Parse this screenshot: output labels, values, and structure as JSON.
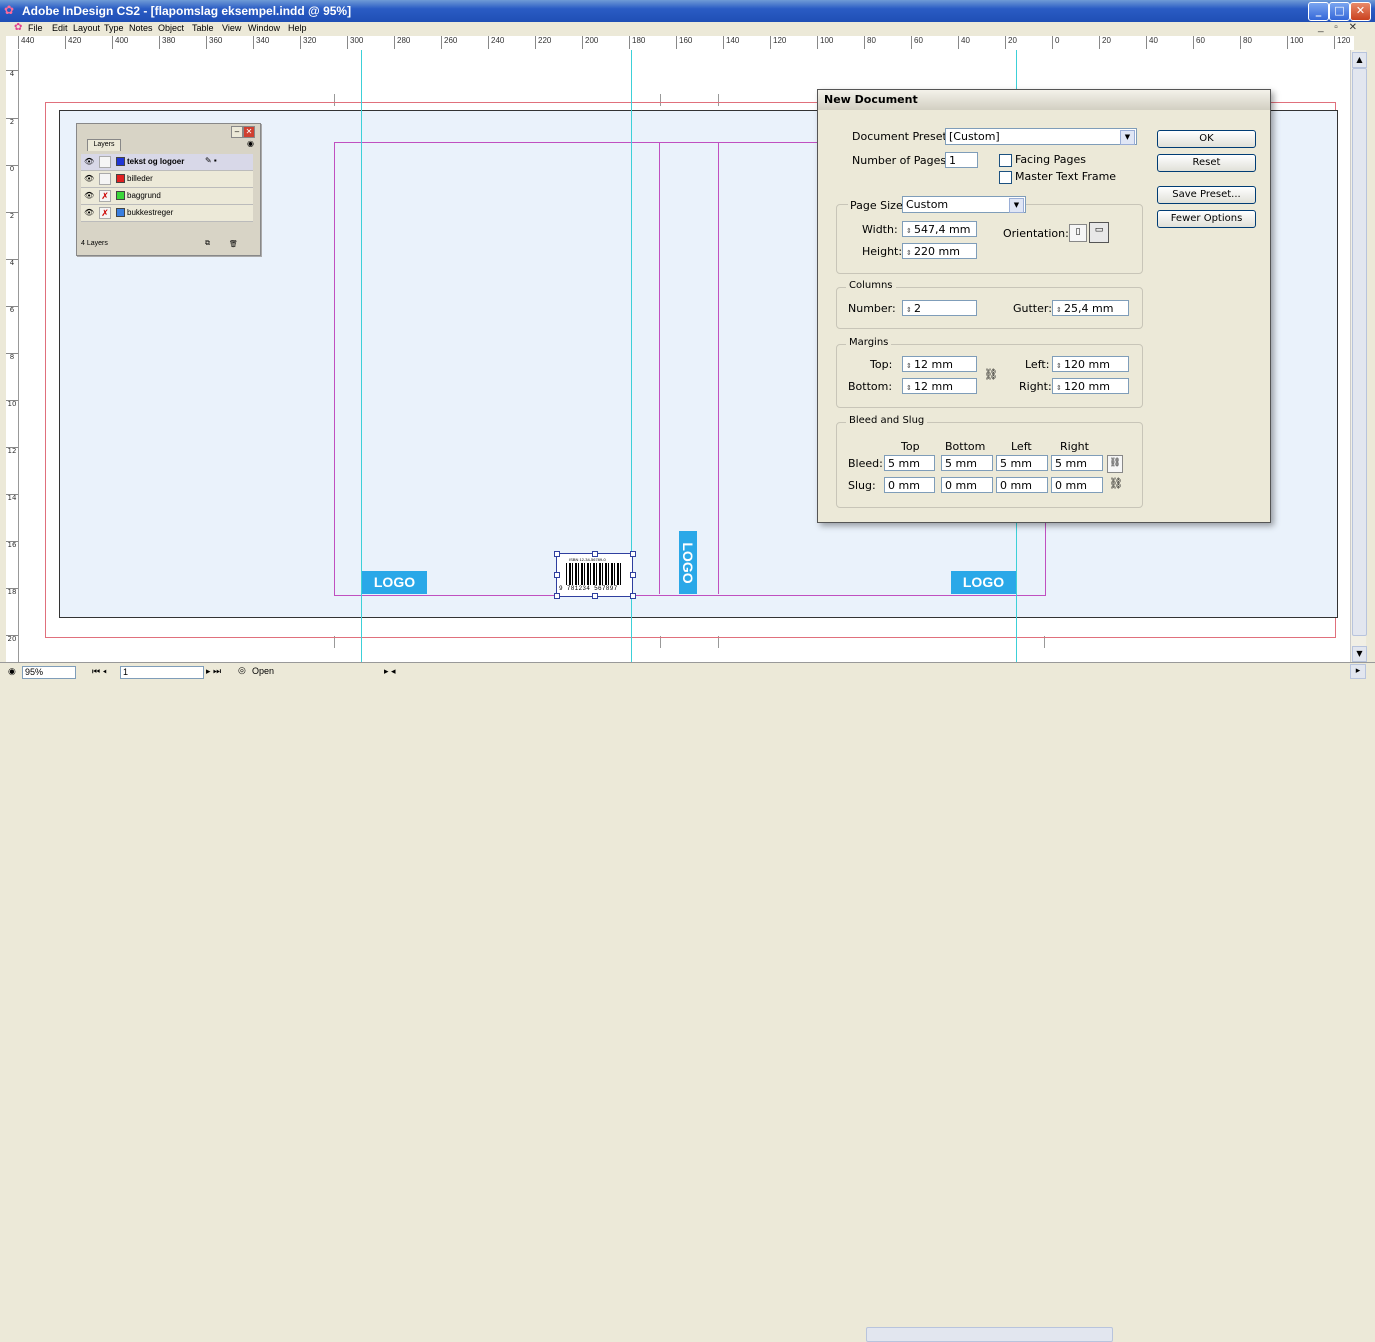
{
  "window": {
    "title": "Adobe InDesign CS2 - [flapomslag eksempel.indd @ 95%]"
  },
  "menu": [
    "File",
    "Edit",
    "Layout",
    "Type",
    "Notes",
    "Object",
    "Table",
    "View",
    "Window",
    "Help"
  ],
  "ruler_top_ticks": [
    "440",
    "420",
    "400",
    "380",
    "360",
    "340",
    "320",
    "300",
    "280",
    "260",
    "240",
    "220",
    "200",
    "180",
    "160",
    "140",
    "120",
    "100",
    "80",
    "60",
    "40",
    "20",
    "0",
    "20",
    "40",
    "60",
    "80",
    "100",
    "120"
  ],
  "ruler_left_ticks": [
    "4",
    "2",
    "0",
    "2",
    "4",
    "6",
    "8",
    "10",
    "12",
    "14",
    "16",
    "18",
    "20"
  ],
  "layers": {
    "tab": "Layers",
    "rows": [
      {
        "name": "tekst og logoer",
        "color": "#1f35d6"
      },
      {
        "name": "billeder",
        "color": "#e02020"
      },
      {
        "name": "baggrund",
        "color": "#3ad63a"
      },
      {
        "name": "bukkestreger",
        "color": "#3a7fe0"
      }
    ],
    "footer": "4 Layers"
  },
  "canvas": {
    "logo_left": "LOGO",
    "logo_spine": "LOGO",
    "logo_right": "LOGO",
    "isbn": "ISBN 12-34-56789-0",
    "barcode_number": "9 781234 567897"
  },
  "dialog": {
    "title": "New Document",
    "preset_label": "Document Preset:",
    "preset_value": "[Custom]",
    "pages_label": "Number of Pages:",
    "pages_value": "1",
    "facing_pages": "Facing Pages",
    "master_text_frame": "Master Text Frame",
    "page_size_group": "Page Size:",
    "page_size_value": "Custom",
    "width_label": "Width:",
    "width_value": "547,4 mm",
    "height_label": "Height:",
    "height_value": "220 mm",
    "orientation_label": "Orientation:",
    "columns_group": "Columns",
    "number_label": "Number:",
    "number_value": "2",
    "gutter_label": "Gutter:",
    "gutter_value": "25,4 mm",
    "margins_group": "Margins",
    "top_label": "Top:",
    "top_value": "12 mm",
    "bottom_label": "Bottom:",
    "bottom_value": "12 mm",
    "left_label": "Left:",
    "left_value": "120 mm",
    "right_label": "Right:",
    "right_value": "120 mm",
    "bleed_group": "Bleed and Slug",
    "col_top": "Top",
    "col_bottom": "Bottom",
    "col_left": "Left",
    "col_right": "Right",
    "bleed_label": "Bleed:",
    "bleed_values": [
      "5 mm",
      "5 mm",
      "5 mm",
      "5 mm"
    ],
    "slug_label": "Slug:",
    "slug_values": [
      "0 mm",
      "0 mm",
      "0 mm",
      "0 mm"
    ],
    "buttons": {
      "ok": "OK",
      "reset": "Reset",
      "save_preset": "Save Preset...",
      "fewer_options": "Fewer Options"
    }
  },
  "status": {
    "zoom": "95%",
    "page": "1",
    "open": "Open"
  }
}
